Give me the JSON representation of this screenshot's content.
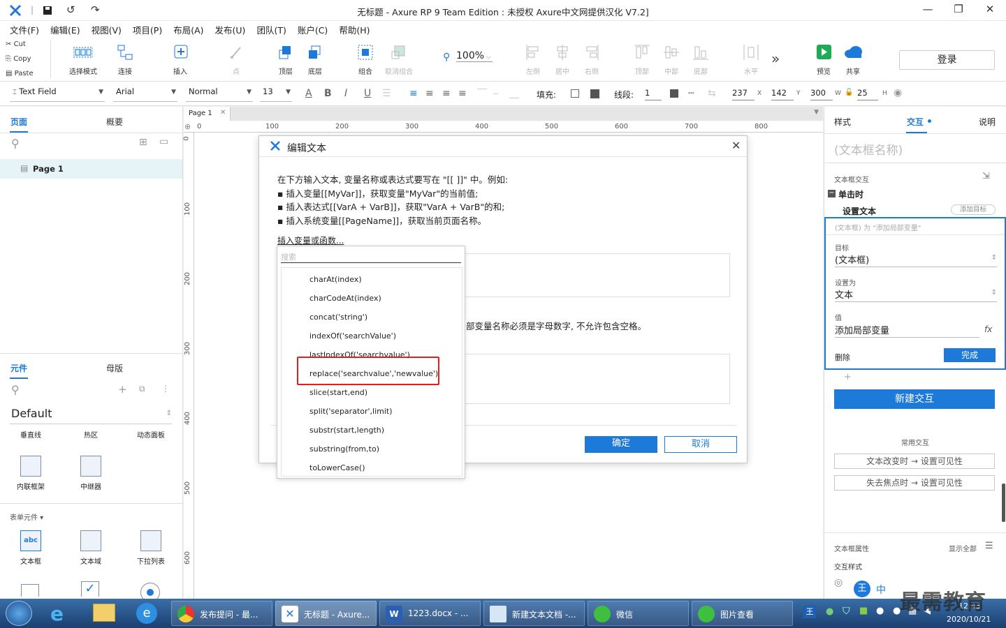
{
  "window": {
    "title": "无标题 - Axure RP 9 Team Edition : 未授权      Axure中文网提供汉化 V7.2]",
    "min": "—",
    "max": "❐",
    "close": "✕"
  },
  "menu": [
    "文件(F)",
    "编辑(E)",
    "视图(V)",
    "项目(P)",
    "布局(A)",
    "发布(U)",
    "团队(T)",
    "账户(C)",
    "帮助(H)"
  ],
  "clipboard": {
    "cut": "Cut",
    "copy": "Copy",
    "paste": "Paste"
  },
  "toolbar": {
    "select_mode": "选择模式",
    "connect": "连接",
    "insert": "插入",
    "point": "点",
    "top_layer": "顶层",
    "bottom_layer": "底层",
    "group": "组合",
    "ungroup": "取消组合",
    "zoom": "100%",
    "align_left": "左侧",
    "align_center": "居中",
    "align_right": "右侧",
    "align_top": "顶部",
    "align_middle": "中部",
    "align_bottom": "底部",
    "distribute_h": "水平",
    "more": "»",
    "preview": "预览",
    "share": "共享",
    "login": "登录"
  },
  "format": {
    "widget_type": "Text Field",
    "font": "Arial",
    "style": "Normal",
    "size": "13",
    "fill_label": "填充:",
    "line_label": "线段:",
    "line_width": "1",
    "x": "237",
    "x_label": "X",
    "y": "142",
    "y_label": "Y",
    "w": "300",
    "w_label": "W",
    "h": "25",
    "h_label": "H"
  },
  "left_panel": {
    "tab_pages": "页面",
    "tab_outline": "概要",
    "page_item": "Page 1",
    "tab_widgets": "元件",
    "tab_masters": "母版",
    "library": "Default",
    "widgets_row1": [
      "垂直线",
      "热区",
      "动态面板"
    ],
    "widgets_row2": [
      "内联框架",
      "中继器"
    ],
    "form_section": "表单元件 ▾",
    "widgets_row3": [
      "文本框",
      "文本域",
      "下拉列表"
    ]
  },
  "canvas": {
    "tab": "Page 1",
    "hruler": [
      "0",
      "100",
      "200",
      "300",
      "400",
      "500",
      "600",
      "700",
      "800"
    ],
    "vruler": [
      "0",
      "100",
      "200",
      "300",
      "400",
      "500",
      "600"
    ]
  },
  "dialog": {
    "title": "编辑文本",
    "intro": [
      "在下方输入文本, 变量名称或表达式要写在 \"[[ ]]\" 中。例如:",
      "▪ 插入变量[[MyVar]]，获取变量\"MyVar\"的当前值;",
      "▪ 插入表达式[[VarA + VarB]]，获取\"VarA + VarB\"的和;",
      "▪ 插入系统变量[[PageName]]，获取当前页面名称。"
    ],
    "insert_link": "插入变量或函数...",
    "local_var_note": "部变量名称必须是字母数字, 不允许包含空格。",
    "ok": "确定",
    "cancel": "取消"
  },
  "func_dropdown": {
    "search_placeholder": "搜索",
    "items": [
      "charAt(index)",
      "charCodeAt(index)",
      "concat('string')",
      "indexOf('searchValue')",
      "lastIndexOf('searchvalue')",
      "replace('searchvalue','newvalue')",
      "slice(start,end)",
      "split('separator',limit)",
      "substr(start,length)",
      "substring(from,to)",
      "toLowerCase()"
    ],
    "highlight_color": "#e02020"
  },
  "right_panel": {
    "tab_style": "样式",
    "tab_interaction": "交互",
    "tab_notes": "说明",
    "name_placeholder": "(文本框名称)",
    "section": "文本框交互",
    "event": "单击时",
    "action": "设置文本",
    "add_target": "添加目标",
    "summary": "(文本框) 为 \"添加局部变量\"",
    "target_label": "目标",
    "target_value": "(文本框)",
    "setto_label": "设置为",
    "setto_value": "文本",
    "value_label": "值",
    "value_value": "添加局部变量",
    "fx": "fx",
    "delete": "删除",
    "done": "完成",
    "plus": "+",
    "new_interaction": "新建交互",
    "common_label": "常用交互",
    "common1": "文本改变时 → 设置可见性",
    "common2": "失去焦点时 → 设置可见性",
    "props_label": "文本框属性",
    "show_all": "显示全部",
    "interaction_style": "交互样式"
  },
  "taskbar": {
    "tasks": [
      "发布提问 - 最...",
      "无标题 - Axure...",
      "1223.docx - ...",
      "新建文本文档 -...",
      "微信",
      "图片查看"
    ],
    "time": "12:43",
    "date": "2020/10/21",
    "ime": "中",
    "watermark": "最需教育"
  },
  "colors": {
    "accent": "#1e7ad8",
    "selection": "#1e7ad8",
    "taskbar": "#1b3f70"
  }
}
